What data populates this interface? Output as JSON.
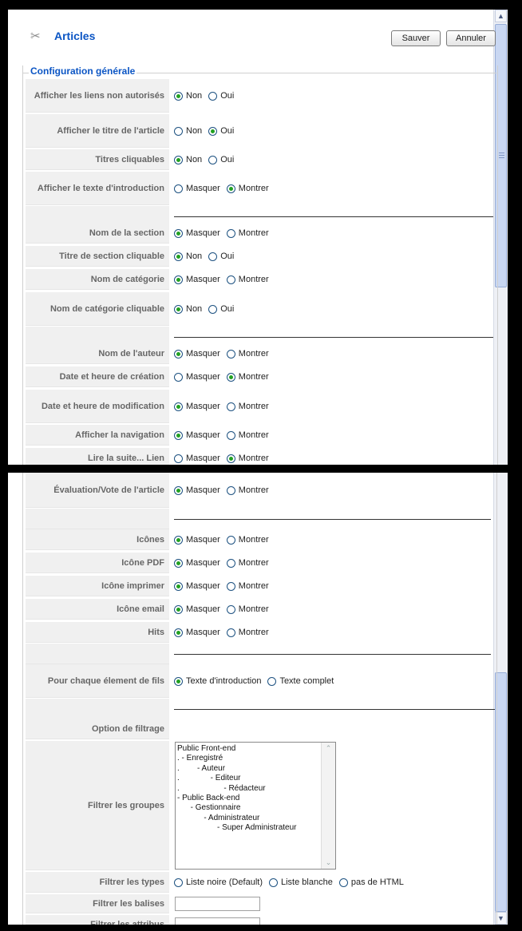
{
  "toolbar": {
    "title": "Articles",
    "save_label": "Sauver",
    "cancel_label": "Annuler"
  },
  "section": {
    "legend": "Configuration générale"
  },
  "top_rows": [
    {
      "label": "Afficher les liens non autorisés",
      "options": [
        "Non",
        "Oui"
      ],
      "selected": 0
    },
    {
      "label": "Afficher le titre de l'article",
      "options": [
        "Non",
        "Oui"
      ],
      "selected": 1
    },
    {
      "label": "Titres cliquables",
      "options": [
        "Non",
        "Oui"
      ],
      "selected": 0
    },
    {
      "label": "Afficher le texte d'introduction",
      "options": [
        "Masquer",
        "Montrer"
      ],
      "selected": 1
    },
    {
      "label": "Nom de la section",
      "options": [
        "Masquer",
        "Montrer"
      ],
      "selected": 0
    },
    {
      "label": "Titre de section cliquable",
      "options": [
        "Non",
        "Oui"
      ],
      "selected": 0
    },
    {
      "label": "Nom de catégorie",
      "options": [
        "Masquer",
        "Montrer"
      ],
      "selected": 0
    },
    {
      "label": "Nom de catégorie cliquable",
      "options": [
        "Non",
        "Oui"
      ],
      "selected": 0
    },
    {
      "label": "Nom de l'auteur",
      "options": [
        "Masquer",
        "Montrer"
      ],
      "selected": 0
    },
    {
      "label": "Date et heure de création",
      "options": [
        "Masquer",
        "Montrer"
      ],
      "selected": 1
    },
    {
      "label": "Date et heure de modification",
      "options": [
        "Masquer",
        "Montrer"
      ],
      "selected": 0
    },
    {
      "label": "Afficher la navigation",
      "options": [
        "Masquer",
        "Montrer"
      ],
      "selected": 0
    },
    {
      "label": "Lire la suite... Lien",
      "options": [
        "Masquer",
        "Montrer"
      ],
      "selected": 1
    }
  ],
  "bottom_rows": [
    {
      "label": "Évaluation/Vote de l'article",
      "options": [
        "Masquer",
        "Montrer"
      ],
      "selected": 0
    },
    {
      "label": "Icônes",
      "options": [
        "Masquer",
        "Montrer"
      ],
      "selected": 0
    },
    {
      "label": "Icône PDF",
      "options": [
        "Masquer",
        "Montrer"
      ],
      "selected": 0
    },
    {
      "label": "Icône imprimer",
      "options": [
        "Masquer",
        "Montrer"
      ],
      "selected": 0
    },
    {
      "label": "Icône email",
      "options": [
        "Masquer",
        "Montrer"
      ],
      "selected": 0
    },
    {
      "label": "Hits",
      "options": [
        "Masquer",
        "Montrer"
      ],
      "selected": 0
    },
    {
      "label": "Pour chaque élement de fils",
      "options": [
        "Texte d'introduction",
        "Texte complet"
      ],
      "selected": 0
    },
    {
      "label": "Filtrer les types",
      "options": [
        "Liste noire (Default)",
        "Liste blanche",
        "pas de HTML"
      ],
      "selected": -1
    }
  ],
  "filter": {
    "option_label": "Option de filtrage",
    "groups_label": "Filtrer les groupes",
    "groups": [
      "Public Front-end",
      ". - Enregistré",
      ".        - Auteur",
      ".              - Editeur",
      ".                    - Rédacteur",
      "- Public Back-end",
      "      - Gestionnaire",
      "            - Administrateur",
      "                  - Super Administrateur"
    ],
    "tags_label": "Filtrer les balises",
    "attrs_label": "Filtrer les attribus"
  }
}
